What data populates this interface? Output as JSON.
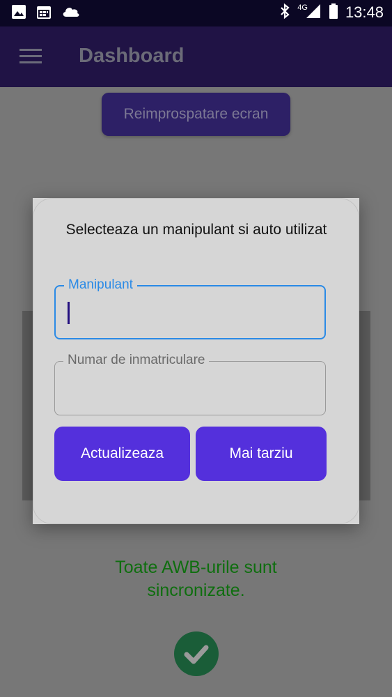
{
  "status_bar": {
    "time": "13:48",
    "network": "4G",
    "icons": [
      "image-icon",
      "calendar-icon",
      "cloud-icon",
      "bluetooth-icon",
      "signal-icon",
      "battery-icon"
    ]
  },
  "app_bar": {
    "title": "Dashboard",
    "menu_icon": "hamburger-menu-icon"
  },
  "main": {
    "refresh_button": "Reimprospatare ecran",
    "sync_status_line1": "Toate AWB-urile sunt",
    "sync_status_line2": "sincronizate.",
    "sync_icon": "check-circle-icon"
  },
  "dialog": {
    "title": "Selecteaza un manipulant si auto utilizat",
    "manipulant_label": "Manipulant",
    "manipulant_value": "",
    "plate_label": "Numar de inmatriculare",
    "plate_value": "",
    "update_button": "Actualizeaza",
    "later_button": "Mai tarziu"
  },
  "colors": {
    "status_bar": "#0b0724",
    "app_bar": "#201345",
    "accent_button": "#5430dc",
    "focused_field": "#2a8ae6",
    "success_text": "#0f6e0f",
    "dialog_bg": "#d6d6d6"
  }
}
